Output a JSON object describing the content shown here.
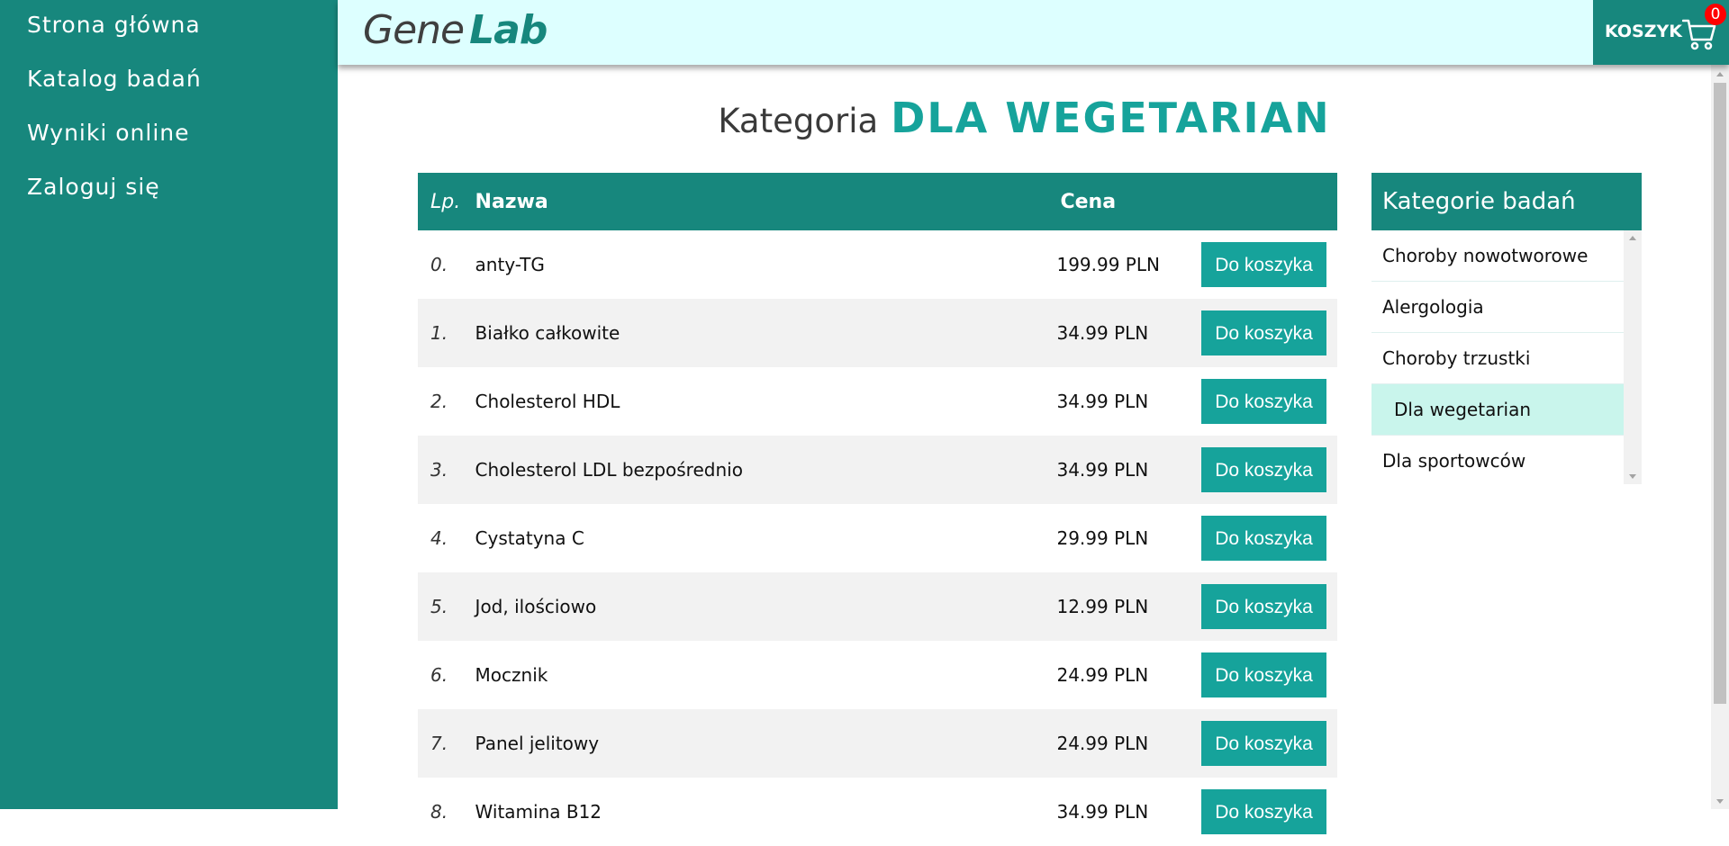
{
  "nav": {
    "items": [
      "Strona główna",
      "Katalog badań",
      "Wyniki online",
      "Zaloguj się"
    ]
  },
  "logo": {
    "part1": "Gene",
    "part2": "Lab"
  },
  "cart": {
    "label": "KOSZYK",
    "count": "0"
  },
  "page": {
    "title_prefix": "Kategoria",
    "title_category": "DLA WEGETARIAN"
  },
  "table": {
    "headers": {
      "lp": "Lp.",
      "name": "Nazwa",
      "price": "Cena"
    },
    "button_label": "Do koszyka",
    "rows": [
      {
        "lp": "0.",
        "name": "anty-TG",
        "price": "199.99 PLN"
      },
      {
        "lp": "1.",
        "name": "Białko całkowite",
        "price": "34.99 PLN"
      },
      {
        "lp": "2.",
        "name": "Cholesterol HDL",
        "price": "34.99 PLN"
      },
      {
        "lp": "3.",
        "name": "Cholesterol LDL bezpośrednio",
        "price": "34.99 PLN"
      },
      {
        "lp": "4.",
        "name": "Cystatyna C",
        "price": "29.99 PLN"
      },
      {
        "lp": "5.",
        "name": "Jod, ilościowo",
        "price": "12.99 PLN"
      },
      {
        "lp": "6.",
        "name": "Mocznik",
        "price": "24.99 PLN"
      },
      {
        "lp": "7.",
        "name": "Panel jelitowy",
        "price": "24.99 PLN"
      },
      {
        "lp": "8.",
        "name": "Witamina B12",
        "price": "34.99 PLN"
      }
    ]
  },
  "categories": {
    "title": "Kategorie badań",
    "items": [
      "Choroby nowotworowe",
      "Alergologia",
      "Choroby trzustki",
      "Dla wegetarian",
      "Dla sportowców"
    ],
    "active_index": 3
  },
  "colors": {
    "primary": "#17877d",
    "accent": "#16a39b",
    "header_bg": "#ddffff",
    "active_category": "#c9f5ec",
    "badge": "#ff0000"
  },
  "icons": {
    "cart": "cart-icon"
  }
}
